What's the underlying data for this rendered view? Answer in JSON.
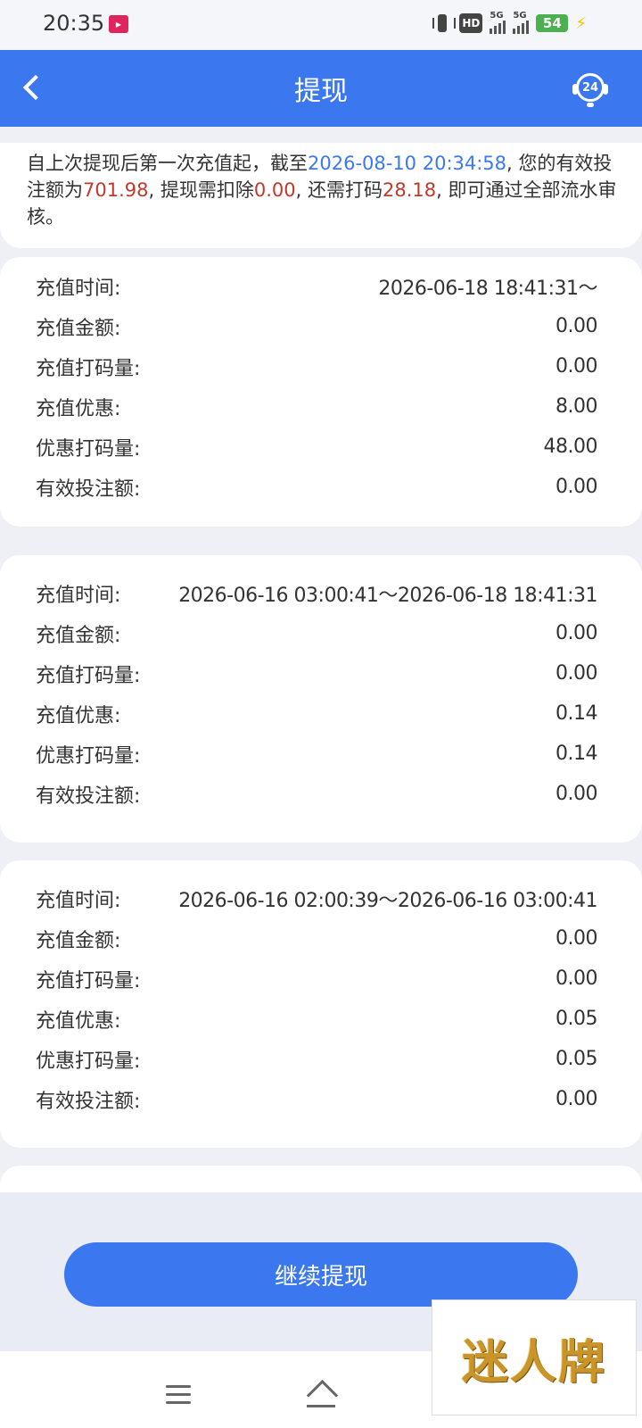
{
  "status_bar": {
    "time": "20:35",
    "hd": "HD",
    "network_1": "5G",
    "network_2": "5G",
    "battery": "54"
  },
  "header": {
    "title": "提现",
    "support_badge": "24"
  },
  "notice": {
    "part1": "自上次提现后第一次充值起，截至",
    "datetime": "2026-08-10 20:34:58",
    "part2": ", 您的有效投注额为",
    "valid_bet": "701.98",
    "part3": ", 提现需扣除",
    "deduction": "0.00",
    "part4": ", 还需打码",
    "remaining": "28.18",
    "part5": ", 即可通过全部流水审核。"
  },
  "labels": {
    "recharge_time": "充值时间:",
    "recharge_amount": "充值金额:",
    "recharge_wager": "充值打码量:",
    "recharge_bonus": "充值优惠:",
    "bonus_wager": "优惠打码量:",
    "valid_bet": "有效投注额:"
  },
  "records": [
    {
      "time": "2026-06-18 18:41:31～",
      "amount": "0.00",
      "wager": "0.00",
      "bonus": "8.00",
      "bonus_wager": "48.00",
      "valid_bet": "0.00"
    },
    {
      "time": "2026-06-16 03:00:41～2026-06-18 18:41:31",
      "amount": "0.00",
      "wager": "0.00",
      "bonus": "0.14",
      "bonus_wager": "0.14",
      "valid_bet": "0.00"
    },
    {
      "time": "2026-06-16 02:00:39～2026-06-16 03:00:41",
      "amount": "0.00",
      "wager": "0.00",
      "bonus": "0.05",
      "bonus_wager": "0.05",
      "valid_bet": "0.00"
    }
  ],
  "continue_button": "继续提现",
  "watermark": "迷人牌",
  "icons": [
    "back-arrow-icon",
    "headset-support-icon",
    "menu-icon",
    "home-icon"
  ],
  "colors": {
    "primary": "#3b78ef",
    "highlight_red": "#c0392b",
    "background": "#eef0f6"
  }
}
